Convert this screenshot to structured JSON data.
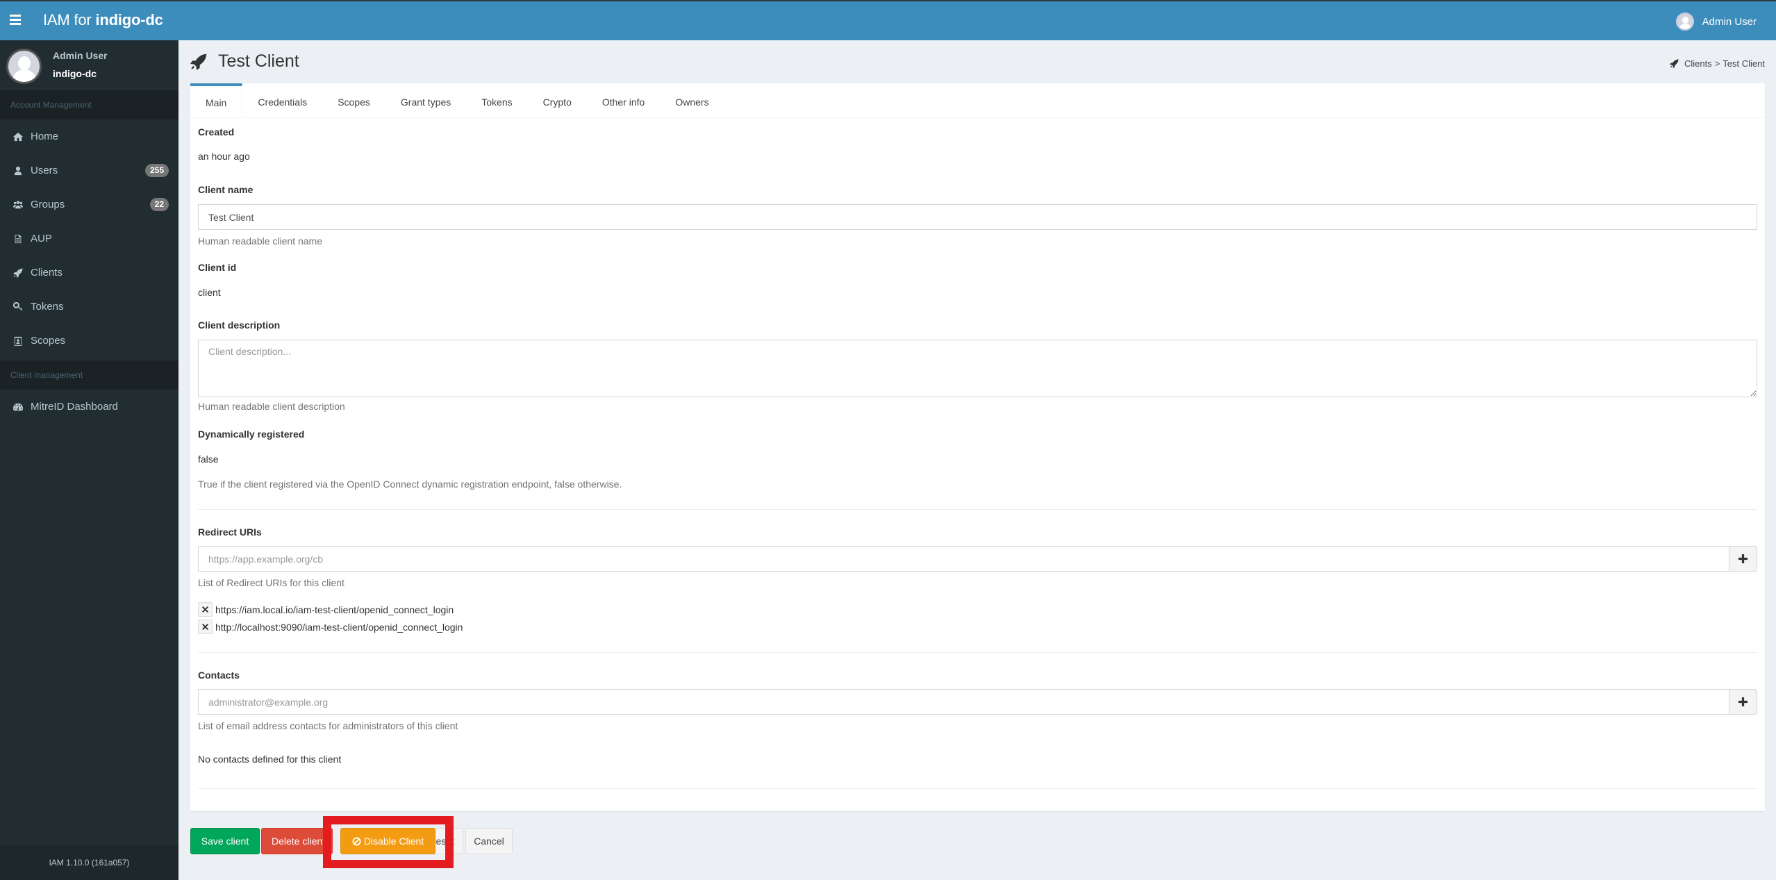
{
  "header": {
    "brand_prefix": "IAM for ",
    "brand_org": "indigo-dc",
    "user_name": "Admin User"
  },
  "sidebar": {
    "user_name": "Admin User",
    "user_org": "indigo-dc",
    "sections": [
      {
        "title": "Account Management",
        "items": [
          {
            "label": "Home",
            "icon": "home-icon"
          },
          {
            "label": "Users",
            "icon": "user-icon",
            "badge": "255"
          },
          {
            "label": "Groups",
            "icon": "users-icon",
            "badge": "22"
          },
          {
            "label": "AUP",
            "icon": "document-icon"
          },
          {
            "label": "Clients",
            "icon": "rocket-icon"
          },
          {
            "label": "Tokens",
            "icon": "key-icon"
          },
          {
            "label": "Scopes",
            "icon": "badge-icon"
          }
        ]
      },
      {
        "title": "Client management",
        "items": [
          {
            "label": "MitreID Dashboard",
            "icon": "dashboard-icon"
          }
        ]
      }
    ],
    "footer": "IAM 1.10.0 (161a057)"
  },
  "page": {
    "title": "Test Client",
    "breadcrumb": [
      "Clients",
      "Test Client"
    ],
    "breadcrumb_sep": ">"
  },
  "tabs": [
    {
      "label": "Main",
      "active": true
    },
    {
      "label": "Credentials"
    },
    {
      "label": "Scopes"
    },
    {
      "label": "Grant types"
    },
    {
      "label": "Tokens"
    },
    {
      "label": "Crypto"
    },
    {
      "label": "Other info"
    },
    {
      "label": "Owners"
    }
  ],
  "form": {
    "created": {
      "label": "Created",
      "value": "an hour ago"
    },
    "client_name": {
      "label": "Client name",
      "value": "Test Client",
      "help": "Human readable client name"
    },
    "client_id": {
      "label": "Client id",
      "value": "client"
    },
    "client_description": {
      "label": "Client description",
      "value": "",
      "placeholder": "Client description...",
      "help": "Human readable client description"
    },
    "dynamically_registered": {
      "label": "Dynamically registered",
      "value": "false",
      "help": "True if the client registered via the OpenID Connect dynamic registration endpoint, false otherwise."
    },
    "redirect_uris": {
      "label": "Redirect URIs",
      "placeholder": "https://app.example.org/cb",
      "help": "List of Redirect URIs for this client",
      "items": [
        "https://iam.local.io/iam-test-client/openid_connect_login",
        "http://localhost:9090/iam-test-client/openid_connect_login"
      ]
    },
    "contacts": {
      "label": "Contacts",
      "placeholder": "administrator@example.org",
      "help": "List of email address contacts for administrators of this client",
      "empty": "No contacts defined for this client"
    }
  },
  "actions": {
    "save": "Save client",
    "delete": "Delete client",
    "disable": "Disable Client",
    "reset": "Reset",
    "cancel": "Cancel"
  },
  "colors": {
    "header": "#3c8dbc",
    "sidebar": "#222d32",
    "save": "#00a65a",
    "delete": "#dd4b39",
    "disable": "#f39c12",
    "highlight": "#e51c1f"
  }
}
